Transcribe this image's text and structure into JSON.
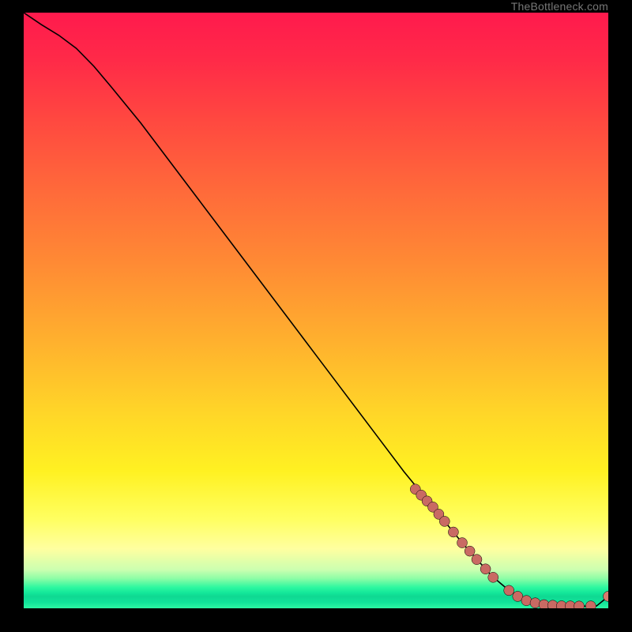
{
  "attribution": "TheBottleneck.com",
  "colors": {
    "page_bg": "#000000",
    "line": "#000000",
    "dot": "#c96a63",
    "dot_last": "#d97a6e"
  },
  "chart_data": {
    "type": "line",
    "title": "",
    "xlabel": "",
    "ylabel": "",
    "xlim": [
      0,
      100
    ],
    "ylim": [
      0,
      100
    ],
    "grid": false,
    "legend": false,
    "series": [
      {
        "name": "curve",
        "x": [
          0,
          3,
          6,
          9,
          12,
          15,
          20,
          25,
          30,
          35,
          40,
          45,
          50,
          55,
          60,
          65,
          70,
          75,
          80,
          83,
          86,
          88,
          90,
          92,
          94,
          96,
          98,
          100
        ],
        "y": [
          100,
          98,
          96.2,
          94,
          91,
          87.5,
          81.5,
          75,
          68.5,
          62,
          55.5,
          49,
          42.5,
          36,
          29.5,
          23,
          17,
          11,
          5.5,
          3,
          1.4,
          0.8,
          0.5,
          0.4,
          0.35,
          0.35,
          0.4,
          2.0
        ]
      }
    ],
    "markers": [
      {
        "series": "curve",
        "x": 67,
        "y": 20
      },
      {
        "series": "curve",
        "x": 68,
        "y": 19
      },
      {
        "series": "curve",
        "x": 69,
        "y": 18
      },
      {
        "series": "curve",
        "x": 70,
        "y": 17
      },
      {
        "series": "curve",
        "x": 71,
        "y": 15.8
      },
      {
        "series": "curve",
        "x": 72,
        "y": 14.6
      },
      {
        "series": "curve",
        "x": 73.5,
        "y": 12.8
      },
      {
        "series": "curve",
        "x": 75,
        "y": 11
      },
      {
        "series": "curve",
        "x": 76.3,
        "y": 9.6
      },
      {
        "series": "curve",
        "x": 77.5,
        "y": 8.2
      },
      {
        "series": "curve",
        "x": 79,
        "y": 6.6
      },
      {
        "series": "curve",
        "x": 80.3,
        "y": 5.2
      },
      {
        "series": "curve",
        "x": 83,
        "y": 3.0
      },
      {
        "series": "curve",
        "x": 84.5,
        "y": 2.0
      },
      {
        "series": "curve",
        "x": 86,
        "y": 1.3
      },
      {
        "series": "curve",
        "x": 87.5,
        "y": 0.9
      },
      {
        "series": "curve",
        "x": 89,
        "y": 0.6
      },
      {
        "series": "curve",
        "x": 90.5,
        "y": 0.5
      },
      {
        "series": "curve",
        "x": 92,
        "y": 0.4
      },
      {
        "series": "curve",
        "x": 93.5,
        "y": 0.38
      },
      {
        "series": "curve",
        "x": 95,
        "y": 0.36
      },
      {
        "series": "curve",
        "x": 97,
        "y": 0.38
      },
      {
        "series": "curve",
        "x": 100,
        "y": 2.0,
        "last": true
      }
    ]
  }
}
